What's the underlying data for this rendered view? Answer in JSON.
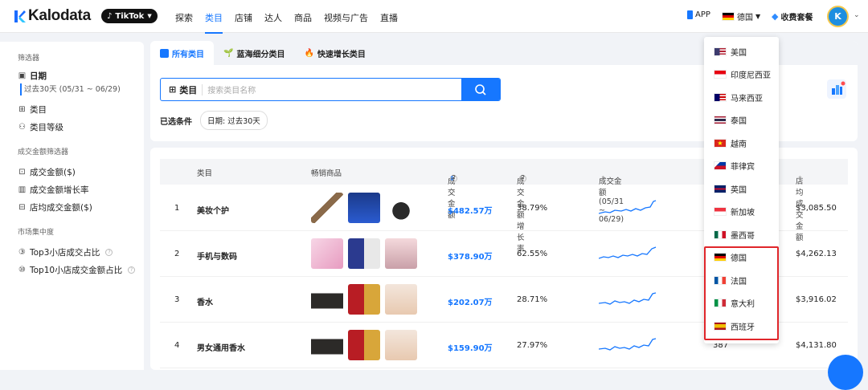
{
  "app": {
    "name": "Kalodata",
    "platform": "TikTok"
  },
  "nav": [
    "探索",
    "类目",
    "店铺",
    "达人",
    "商品",
    "视频与广告",
    "直播"
  ],
  "nav_active": "类目",
  "header": {
    "app_label": "APP",
    "country": "德国",
    "pricing": "收费套餐",
    "avatar_letter": "K"
  },
  "sidebar": {
    "filter_title": "筛选器",
    "date_label": "日期",
    "date_value": "过去30天 (05/31 ~ 06/29)",
    "cat_label": "类目",
    "cat_level_label": "类目等级",
    "gmv_filter_title": "成交金额筛选器",
    "gmv_items": [
      "成交金额($)",
      "成交金额增长率",
      "店均成交金额($)"
    ],
    "market_title": "市场集中度",
    "market_items": [
      "Top3小店成交占比",
      "Top10小店成交金额占比"
    ]
  },
  "tabs": [
    "所有类目",
    "蓝海细分类目",
    "快速增长类目"
  ],
  "search": {
    "label": "类目",
    "placeholder": "搜索类目名称"
  },
  "selected": {
    "label": "已选条件",
    "chip": "日期: 过去30天"
  },
  "table": {
    "headers": [
      "类目",
      "畅销商品",
      "成交金额",
      "成交金额增长率",
      "成交金额(05/31 ~ 06/29)",
      "店均成交金额"
    ],
    "rows": [
      {
        "rank": "1",
        "category": "美妆个护",
        "gmv": "$482.57万",
        "growth": "38.79%",
        "count": "",
        "avg": "$3,085.50"
      },
      {
        "rank": "2",
        "category": "手机与数码",
        "gmv": "$378.90万",
        "growth": "62.55%",
        "count": "",
        "avg": "$4,262.13"
      },
      {
        "rank": "3",
        "category": "香水",
        "gmv": "$202.07万",
        "growth": "28.71%",
        "count": "",
        "avg": "$3,916.02"
      },
      {
        "rank": "4",
        "category": "男女通用香水",
        "gmv": "$159.90万",
        "growth": "27.97%",
        "count": "387",
        "avg": "$4,131.80"
      }
    ]
  },
  "countries": [
    "美国",
    "印度尼西亚",
    "马来西亚",
    "泰国",
    "越南",
    "菲律宾",
    "英国",
    "新加坡",
    "墨西哥",
    "德国",
    "法国",
    "意大利",
    "西班牙"
  ],
  "highlighted_countries": [
    "德国",
    "法国",
    "意大利",
    "西班牙"
  ],
  "colors": {
    "accent": "#1677ff",
    "highlight": "#e0262b"
  }
}
